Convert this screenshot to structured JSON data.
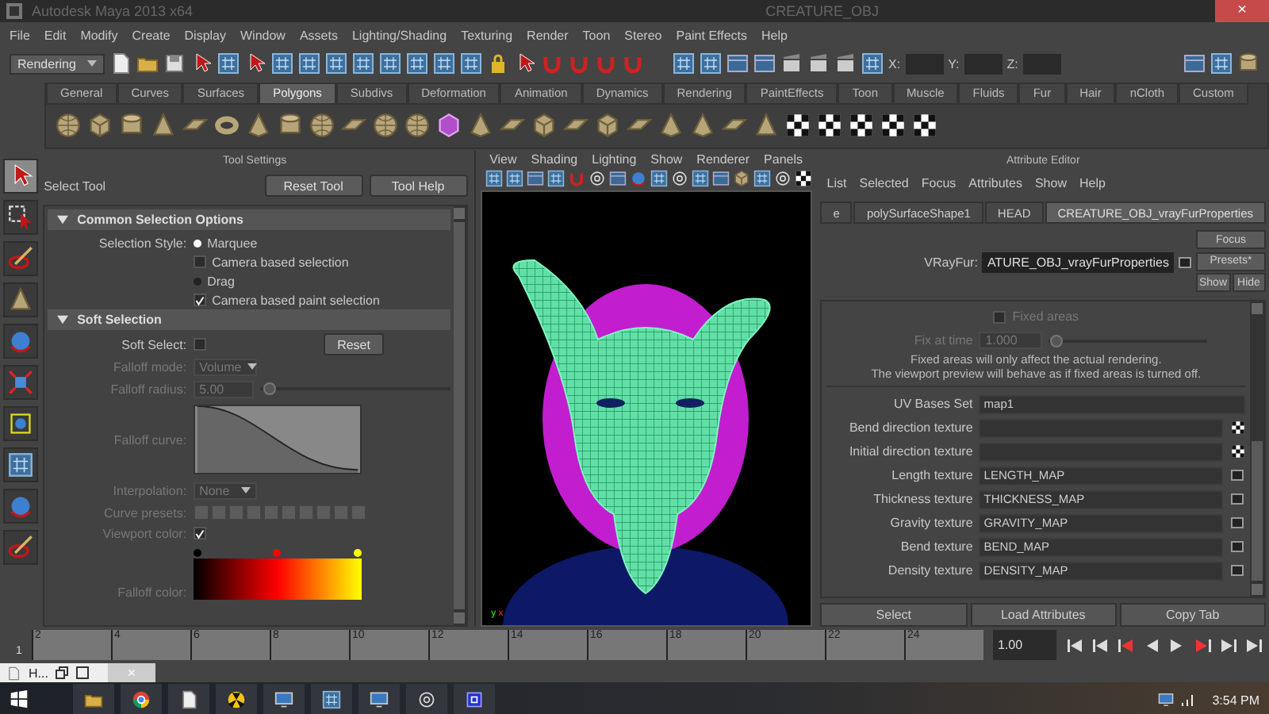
{
  "window": {
    "title": "Autodesk Maya 2013 x64",
    "title_suffix": "CREATURE_OBJ",
    "close": "×"
  },
  "menu_bar": [
    "File",
    "Edit",
    "Modify",
    "Create",
    "Display",
    "Window",
    "Assets",
    "Lighting/Shading",
    "Texturing",
    "Render",
    "Toon",
    "Stereo",
    "Paint Effects",
    "Help"
  ],
  "status_line": {
    "menu_set": "Rendering",
    "x_label": "X:",
    "y_label": "Y:",
    "z_label": "Z:"
  },
  "shelf_tabs": [
    {
      "label": "General",
      "selected": false
    },
    {
      "label": "Curves",
      "selected": false
    },
    {
      "label": "Surfaces",
      "selected": false
    },
    {
      "label": "Polygons",
      "selected": true
    },
    {
      "label": "Subdivs",
      "selected": false
    },
    {
      "label": "Deformation",
      "selected": false
    },
    {
      "label": "Animation",
      "selected": false
    },
    {
      "label": "Dynamics",
      "selected": false
    },
    {
      "label": "Rendering",
      "selected": false
    },
    {
      "label": "PaintEffects",
      "selected": false
    },
    {
      "label": "Toon",
      "selected": false
    },
    {
      "label": "Muscle",
      "selected": false
    },
    {
      "label": "Fluids",
      "selected": false
    },
    {
      "label": "Fur",
      "selected": false
    },
    {
      "label": "Hair",
      "selected": false
    },
    {
      "label": "nCloth",
      "selected": false
    },
    {
      "label": "Custom",
      "selected": false
    }
  ],
  "tool_settings": {
    "title": "Tool Settings",
    "tool_name": "Select Tool",
    "buttons": [
      "Reset Tool",
      "Tool Help"
    ],
    "sections": [
      {
        "title": "Common Selection Options",
        "expanded": true,
        "rows": [
          {
            "kind": "radio",
            "label": "Selection Style:",
            "option": "Marquee",
            "selected": true
          },
          {
            "kind": "checkbox",
            "option": "Camera based selection",
            "checked": false
          },
          {
            "kind": "radio",
            "option": "Drag",
            "selected": false
          },
          {
            "kind": "checkbox",
            "option": "Camera based paint selection",
            "checked": true
          }
        ]
      },
      {
        "title": "Soft Selection",
        "expanded": true,
        "rows": [
          {
            "kind": "checkbox",
            "label": "Soft Select:",
            "checked": false,
            "disabled": false,
            "button": "Reset"
          },
          {
            "kind": "dropdown",
            "label": "Falloff mode:",
            "value": "Volume",
            "disabled": true
          },
          {
            "kind": "slider",
            "label": "Falloff radius:",
            "value": "5.00",
            "level": 0.05,
            "disabled": true
          },
          {
            "kind": "curve",
            "label": "Falloff curve:",
            "disabled": true
          },
          {
            "kind": "dropdown",
            "label": "Interpolation:",
            "value": "None",
            "disabled": true
          },
          {
            "kind": "presets",
            "label": "Curve presets:",
            "disabled": true
          },
          {
            "kind": "checkbox",
            "label": "Viewport color:",
            "checked": true,
            "disabled": true
          },
          {
            "kind": "gradient",
            "label": "Falloff color:",
            "disabled": true,
            "markers": [
              {
                "color": "#000000"
              },
              {
                "color": "#ff0000"
              },
              {
                "color": "#ffff00"
              }
            ]
          }
        ]
      }
    ]
  },
  "viewport": {
    "menus": [
      "View",
      "Shading",
      "Lighting",
      "Show",
      "Renderer",
      "Panels"
    ],
    "axis_labels": [
      "y",
      "x"
    ]
  },
  "attribute_editor": {
    "title": "Attribute Editor",
    "menus": [
      "List",
      "Selected",
      "Focus",
      "Attributes",
      "Show",
      "Help"
    ],
    "tabs": [
      {
        "label": "e",
        "selected": false
      },
      {
        "label": "polySurfaceShape1",
        "selected": false
      },
      {
        "label": "HEAD",
        "selected": false
      },
      {
        "label": "CREATURE_OBJ_vrayFurProperties",
        "selected": true
      }
    ],
    "node_label": "VRayFur:",
    "node_value": "ATURE_OBJ_vrayFurProperties",
    "side_buttons": [
      "Focus",
      "Presets*",
      "Show",
      "Hide"
    ],
    "fixed_areas": {
      "label": "Fixed areas",
      "checked": false
    },
    "fix_at_time": {
      "label": "Fix at time",
      "value": "1.000",
      "level": 0.05
    },
    "notes": [
      "Fixed areas will only affect the actual rendering.",
      "The viewport preview will behave as if fixed areas is turned off."
    ],
    "attributes": [
      {
        "label": "UV Bases Set",
        "value": "map1",
        "kind": "text"
      },
      {
        "label": "Bend direction texture",
        "kind": "checker"
      },
      {
        "label": "Initial direction texture",
        "kind": "checker"
      },
      {
        "label": "Length texture",
        "value": "LENGTH_MAP",
        "kind": "map"
      },
      {
        "label": "Thickness texture",
        "value": "THICKNESS_MAP",
        "kind": "map"
      },
      {
        "label": "Gravity texture",
        "value": "GRAVITY_MAP",
        "kind": "map"
      },
      {
        "label": "Bend texture",
        "value": "BEND_MAP",
        "kind": "map"
      },
      {
        "label": "Density texture",
        "value": "DENSITY_MAP",
        "kind": "map"
      }
    ],
    "bottom_buttons": [
      "Select",
      "Load Attributes",
      "Copy Tab"
    ]
  },
  "timeline": {
    "start": "1",
    "ticks": [
      "2",
      "4",
      "6",
      "8",
      "10",
      "12",
      "14",
      "16",
      "18",
      "20",
      "22",
      "24"
    ],
    "current_time": "1.00"
  },
  "minimized_window": {
    "title": "H...",
    "close": "×"
  },
  "taskbar": {
    "clock": "3:54 PM"
  }
}
